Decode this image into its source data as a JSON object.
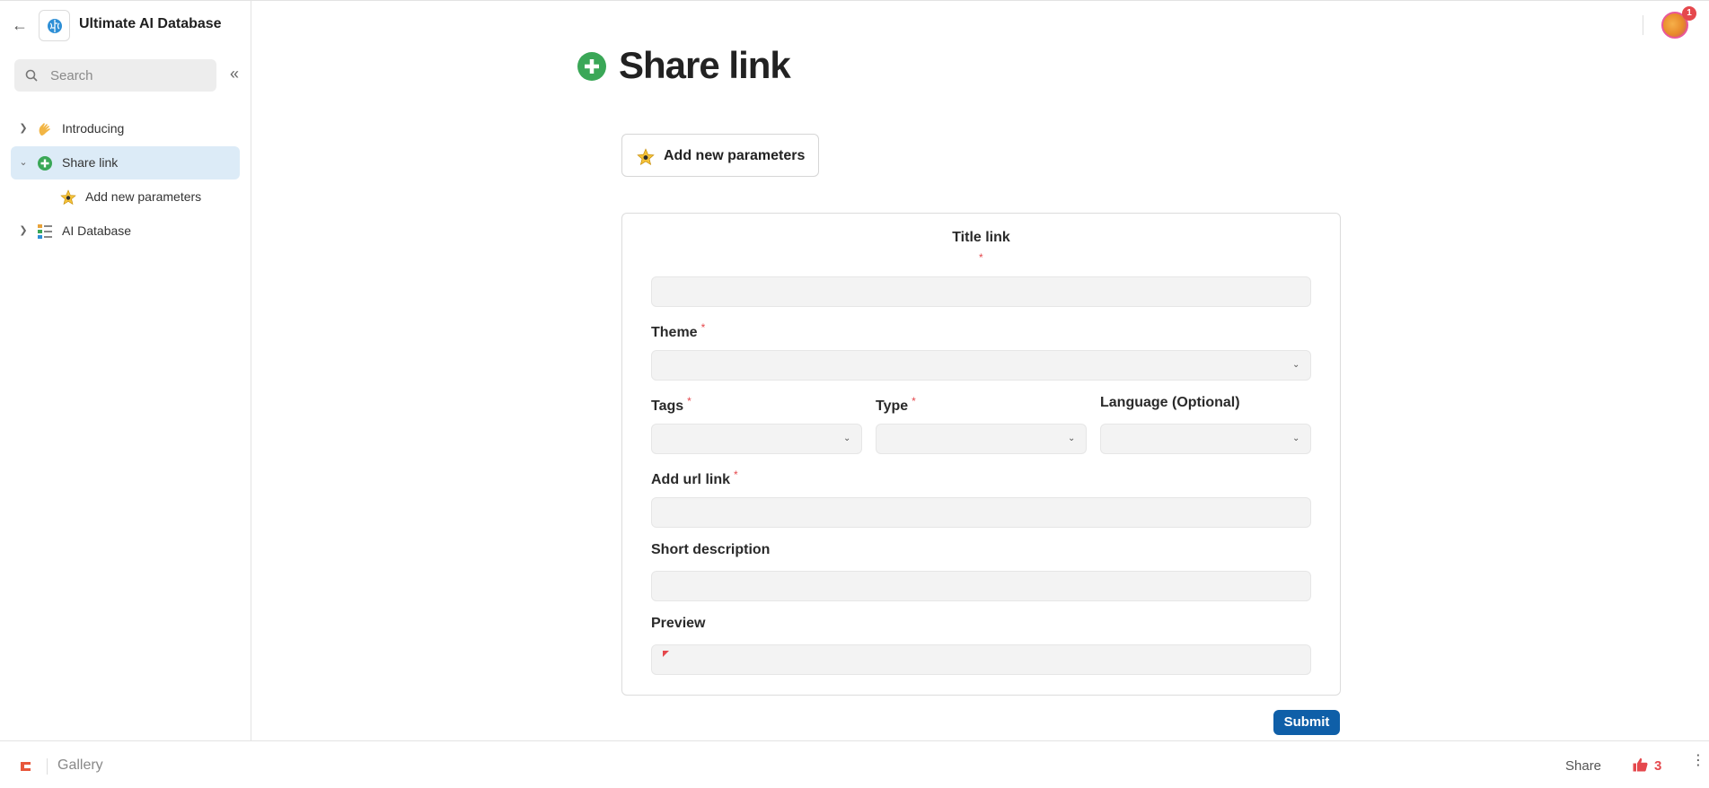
{
  "app": {
    "name": "Ultimate AI Database"
  },
  "sidebar": {
    "search_placeholder": "Search",
    "items": [
      {
        "label": "Introducing",
        "icon": "waving-hand-icon",
        "expanded": false
      },
      {
        "label": "Share link",
        "icon": "plus-circle-icon",
        "expanded": true,
        "active": true
      },
      {
        "label": "Add new parameters",
        "icon": "star-icon",
        "sub": true
      },
      {
        "label": "AI Database",
        "icon": "list-icon",
        "expanded": false
      }
    ]
  },
  "header": {
    "notification_count": "1"
  },
  "page": {
    "title": "Share link",
    "param_button_label": "Add new parameters"
  },
  "form": {
    "title_link_label": "Title link",
    "required_mark": "*",
    "theme_label": "Theme",
    "tags_label": "Tags",
    "type_label": "Type",
    "language_label": "Language (Optional)",
    "url_label": "Add url link",
    "short_desc_label": "Short description",
    "preview_label": "Preview",
    "submit_label": "Submit"
  },
  "footer": {
    "gallery_label": "Gallery",
    "share_label": "Share",
    "like_count": "3"
  },
  "colors": {
    "accent": "#0f5fa8",
    "active_bg": "#dcebf7",
    "required": "#e5484d",
    "plus_green": "#3aa757"
  }
}
